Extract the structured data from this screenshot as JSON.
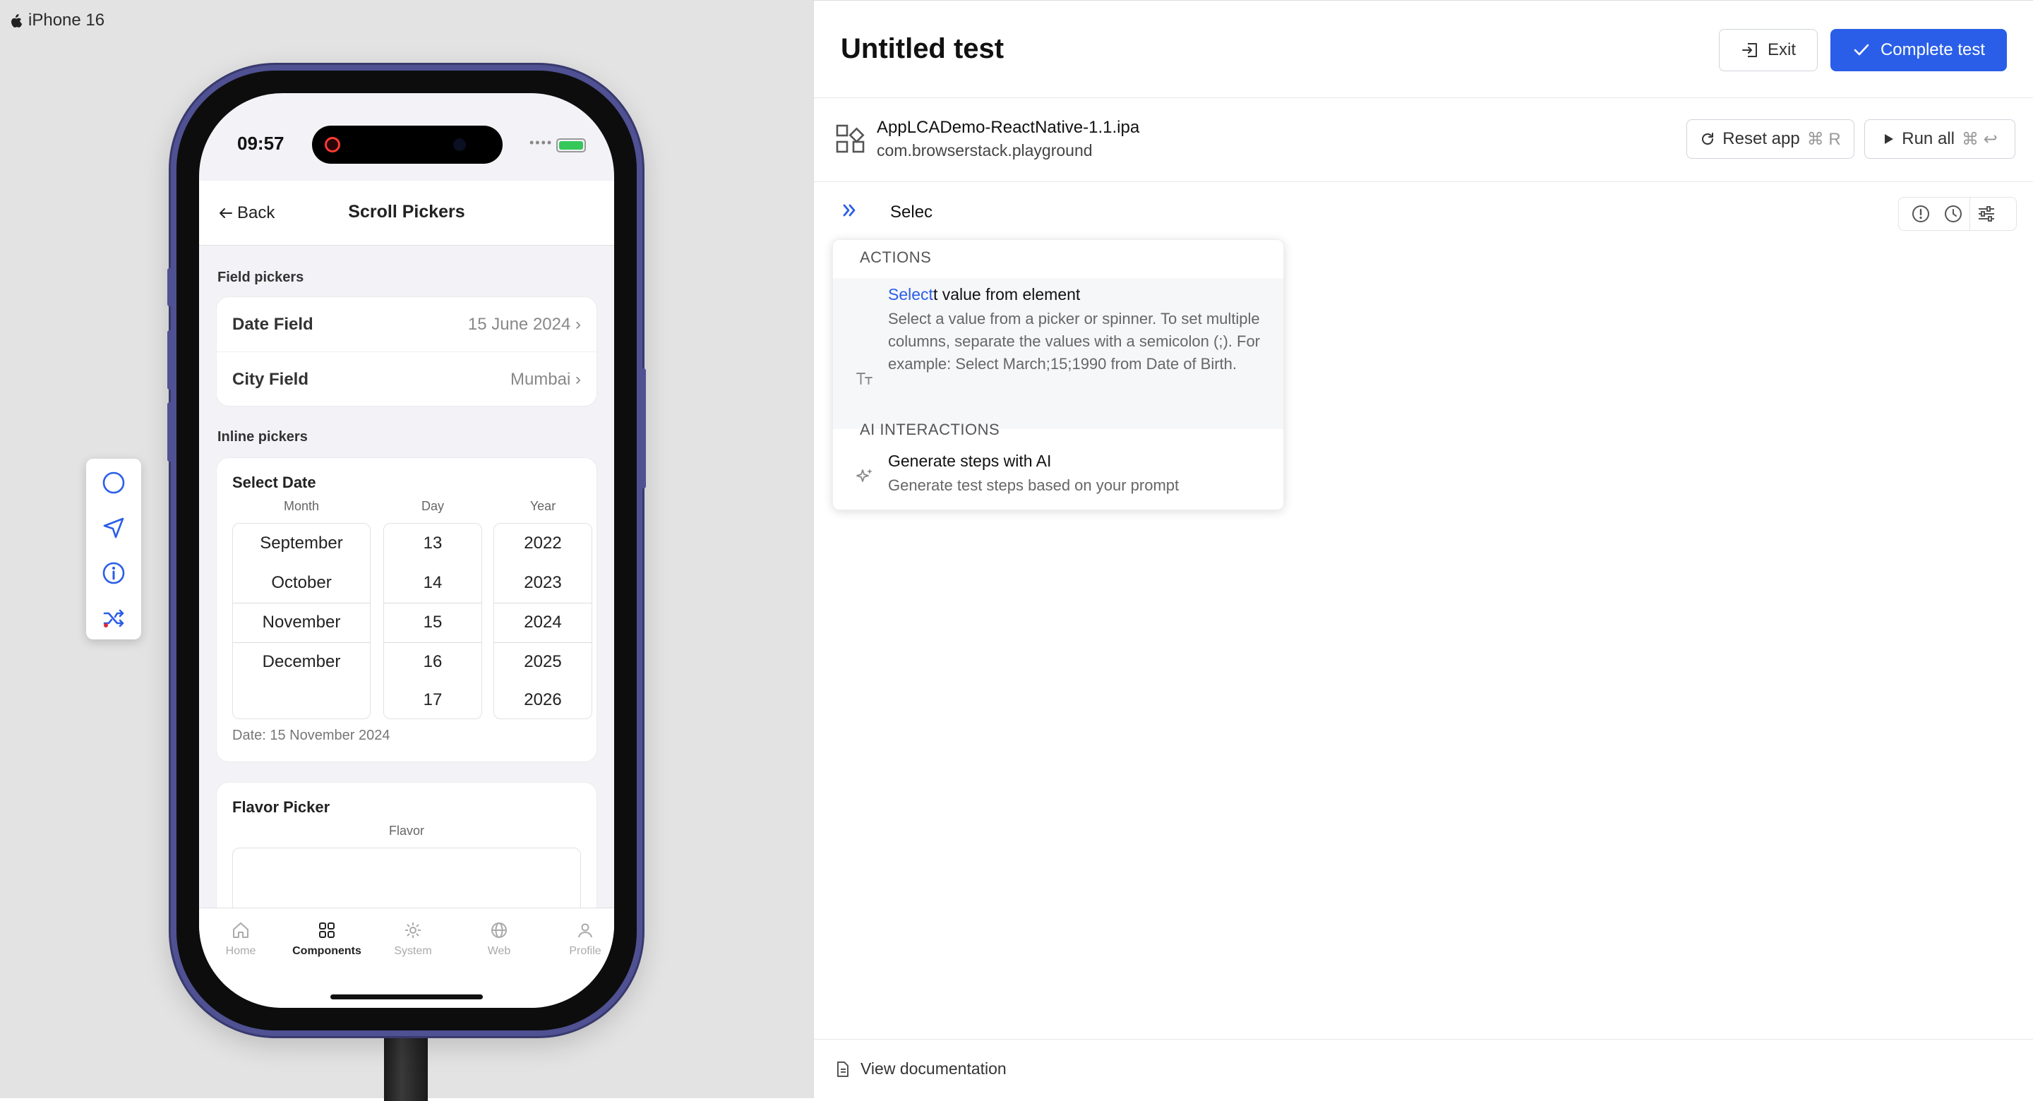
{
  "device": {
    "label": "iPhone 16",
    "time": "09:57"
  },
  "phone_app": {
    "back_label": "Back",
    "title": "Scroll Pickers",
    "field_section": "Field pickers",
    "fields": [
      {
        "label": "Date Field",
        "value": "15 June 2024 ›"
      },
      {
        "label": "City Field",
        "value": "Mumbai ›"
      }
    ],
    "inline_section": "Inline pickers",
    "select_date": {
      "title": "Select Date",
      "month_header": "Month",
      "day_header": "Day",
      "year_header": "Year",
      "months": [
        "September",
        "October",
        "November",
        "December"
      ],
      "days": [
        "13",
        "14",
        "15",
        "16",
        "17"
      ],
      "years": [
        "2022",
        "2023",
        "2024",
        "2025",
        "2026"
      ],
      "date_text": "Date: 15 November 2024"
    },
    "flavor": {
      "title": "Flavor Picker",
      "header": "Flavor"
    },
    "tabs": [
      "Home",
      "Components",
      "System",
      "Web",
      "Profile"
    ],
    "active_tab": "Components"
  },
  "side_toolbar": {
    "icons": [
      "circle-icon",
      "send-icon",
      "info-icon",
      "shuffle-icon"
    ]
  },
  "test_panel": {
    "title": "Untitled test",
    "exit_label": "Exit",
    "complete_label": "Complete test",
    "app_name": "AppLCADemo-ReactNative-1.1.ipa",
    "bundle_id": "com.browserstack.playground",
    "reset_label": "Reset app",
    "reset_kbd": "⌘ R",
    "run_label": "Run all",
    "run_kbd": "⌘ ↩",
    "step_input_value": "Selec",
    "suggestions": {
      "actions_header": "ACTIONS",
      "action_match": "Select",
      "action_rest": "t value from element",
      "action_desc": "Select a value from a picker or spinner. To set multiple columns, separate the values with a semicolon (;). For example: Select March;15;1990 from Date of Birth.",
      "ai_header": "AI INTERACTIONS",
      "ai_title": "Generate steps with AI",
      "ai_desc": "Generate test steps based on your prompt"
    },
    "footer_link": "View documentation",
    "accent": "#2a5ee8"
  }
}
